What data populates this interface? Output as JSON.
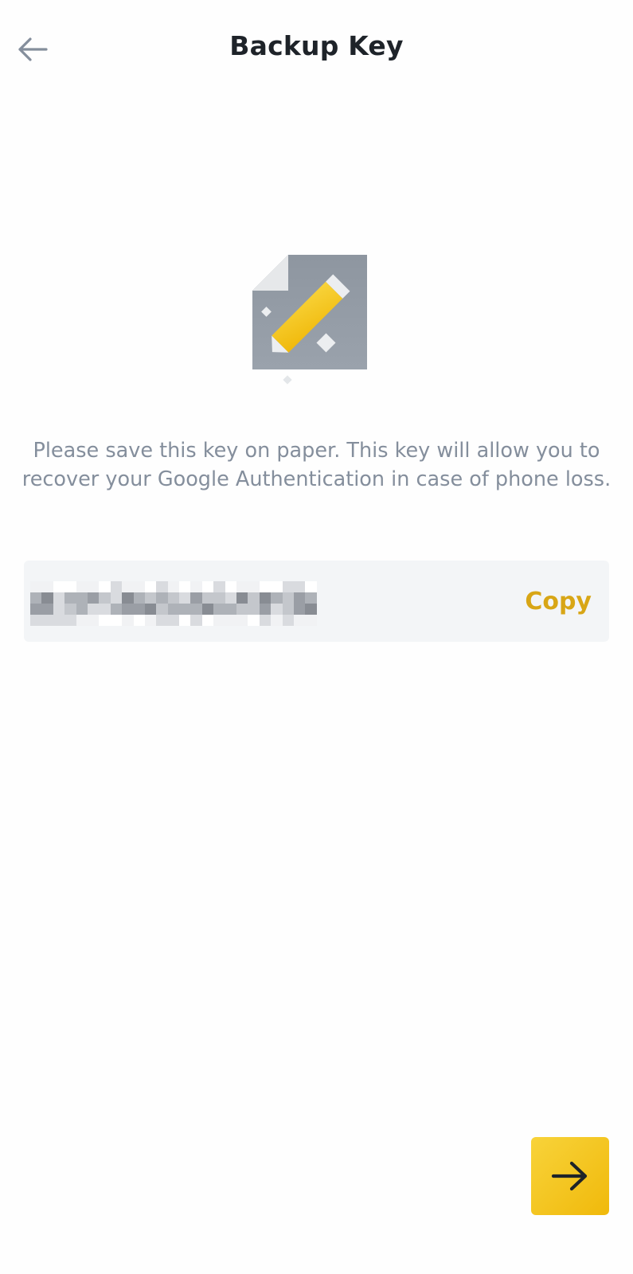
{
  "header": {
    "title": "Backup Key",
    "back_icon": "arrow-left-icon"
  },
  "illustration": {
    "icon": "paper-pencil-icon",
    "colors": {
      "paper": "#8a929c",
      "corner": "#e8eaec",
      "pencil": "#f0b90b"
    }
  },
  "description": "Please save this key on paper. This key will allow you to recover your Google Authentication in case of phone loss.",
  "key_field": {
    "value_obscured": true,
    "copy_label": "Copy"
  },
  "next_button": {
    "icon": "arrow-right-icon"
  },
  "colors": {
    "accent": "#f0b90b",
    "copy_text": "#d8a616",
    "title_text": "#1e2329",
    "body_text": "#848e9c",
    "field_bg": "#f3f5f7"
  }
}
